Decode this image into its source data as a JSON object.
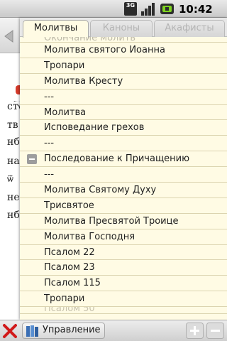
{
  "status_bar": {
    "network": "3G",
    "time": "10:42 AM"
  },
  "tabs": [
    {
      "label": "Молитвы",
      "active": true
    },
    {
      "label": "Каноны",
      "active": false
    },
    {
      "label": "Акафисты",
      "active": false
    }
  ],
  "list": {
    "cut_off_top": "Окончание молитв",
    "items": [
      "Молитва святого Иоанна",
      "Тропари",
      "Молитва Кресту",
      "---",
      "Молитва",
      "Исповедание грехов",
      "---"
    ],
    "section_header": "Последование к Причащению",
    "section_items": [
      "---",
      "Молитва Святому Духу",
      "Трисвятое",
      "Молитва Пресвятой Троице",
      "Молитва Господня",
      "Псалом 22",
      "Псалом 23",
      "Псалом 115",
      "Тропари"
    ],
    "cut_off_bottom": "Псалом 50"
  },
  "background_text": [
    "ст͡ѡ",
    "тв",
    "нб",
    "на",
    "ѿ",
    "не",
    "нб"
  ],
  "bottom_bar": {
    "manage_label": "Управление"
  }
}
